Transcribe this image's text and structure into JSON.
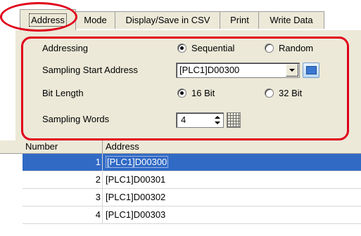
{
  "tabs": [
    {
      "label": "Address",
      "active": true
    },
    {
      "label": "Mode"
    },
    {
      "label": "Display/Save in CSV"
    },
    {
      "label": "Print"
    },
    {
      "label": "Write Data"
    }
  ],
  "settings": {
    "addressing_label": "Addressing",
    "addressing_options": [
      {
        "label": "Sequential",
        "selected": true
      },
      {
        "label": "Random",
        "selected": false
      }
    ],
    "start_address_label": "Sampling Start Address",
    "start_address_value": "[PLC1]D00300",
    "bit_length_label": "Bit Length",
    "bit_length_options": [
      {
        "label": "16 Bit",
        "selected": true
      },
      {
        "label": "32 Bit",
        "selected": false
      }
    ],
    "sampling_words_label": "Sampling Words",
    "sampling_words_value": "4"
  },
  "table": {
    "columns": [
      "Number",
      "Address"
    ],
    "rows": [
      {
        "number": "1",
        "address": "[PLC1]D00300",
        "selected": true
      },
      {
        "number": "2",
        "address": "[PLC1]D00301",
        "selected": false
      },
      {
        "number": "3",
        "address": "[PLC1]D00302",
        "selected": false
      },
      {
        "number": "4",
        "address": "[PLC1]D00303",
        "selected": false
      }
    ]
  },
  "colors": {
    "annotation": "#e0001b",
    "selection": "#316ac5",
    "panel": "#ece9d8"
  },
  "icons": {
    "browse_button": "address-browse-icon",
    "grid_button": "keypad-icon"
  }
}
